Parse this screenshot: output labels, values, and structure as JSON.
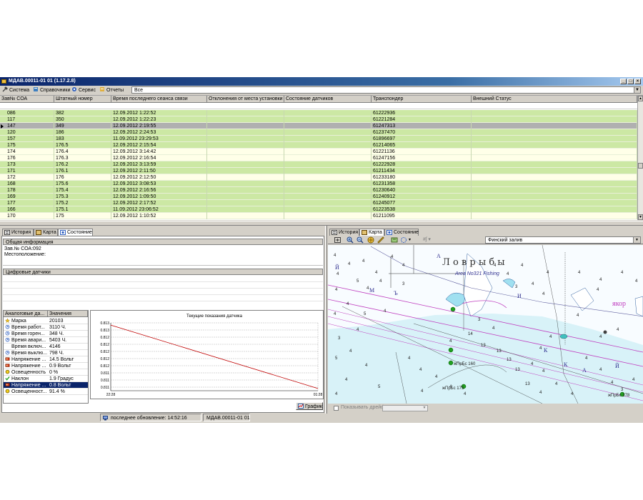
{
  "window": {
    "title": "МДАВ.00011-01 01 (1.17.2.8)"
  },
  "menu": {
    "items": [
      "Система",
      "Справочники",
      "Сервис",
      "Отчеты"
    ],
    "filter_value": "Все"
  },
  "grid": {
    "columns": [
      "Зав№ СОА",
      "Штатный номер",
      "Время последнего сеанса связи",
      "Отклонения от места установки",
      "Состояние датчиков",
      "Транспондер",
      "Внешний Статус"
    ],
    "rows": [
      {
        "zav": "086",
        "num": "382",
        "time": "12.09.2012 1:22:52",
        "tr": "61222936"
      },
      {
        "zav": "117",
        "num": "350",
        "time": "12.09.2012 1:22:23",
        "tr": "61221284"
      },
      {
        "zav": "147",
        "num": "349",
        "time": "12.09.2012 2:19:55",
        "tr": "61247313"
      },
      {
        "zav": "120",
        "num": "186",
        "time": "12.09.2012 2:24:53",
        "tr": "61237470"
      },
      {
        "zav": "157",
        "num": "183",
        "time": "11.09.2012 23:29:53",
        "tr": "61896697"
      },
      {
        "zav": "175",
        "num": "176.5",
        "time": "12.09.2012 2:15:54",
        "tr": "61214065"
      },
      {
        "zav": "174",
        "num": "176.4",
        "time": "12.09.2012 3:14:42",
        "tr": "61221136"
      },
      {
        "zav": "176",
        "num": "176.3",
        "time": "12.09.2012 2:16:54",
        "tr": "61247156"
      },
      {
        "zav": "173",
        "num": "176.2",
        "time": "12.09.2012 3:13:59",
        "tr": "61222928"
      },
      {
        "zav": "171",
        "num": "176.1",
        "time": "12.09.2012 2:11:50",
        "tr": "61211434"
      },
      {
        "zav": "172",
        "num": "176",
        "time": "12.09.2012 2:12:50",
        "tr": "61233180"
      },
      {
        "zav": "168",
        "num": "175.6",
        "time": "12.09.2012 3:08:53",
        "tr": "61231358"
      },
      {
        "zav": "178",
        "num": "175.4",
        "time": "12.09.2012 2:16:56",
        "tr": "61230640"
      },
      {
        "zav": "169",
        "num": "175.3",
        "time": "12.09.2012 1:09:50",
        "tr": "61240912"
      },
      {
        "zav": "177",
        "num": "175.2",
        "time": "12.09.2012 2:17:52",
        "tr": "61245077"
      },
      {
        "zav": "166",
        "num": "175.1",
        "time": "11.09.2012 23:06:52",
        "tr": "61223538"
      },
      {
        "zav": "170",
        "num": "175",
        "time": "12.09.2012 1:10:52",
        "tr": "61211095"
      }
    ]
  },
  "left_panel": {
    "tabs": [
      "История",
      "Карта",
      "Состояние"
    ],
    "general_title": "Общая информация",
    "zav_label": "Зав.№ СОА:092",
    "location_label": "Местоположение:",
    "digital_title": "Цифровые датчики",
    "analog_headers": [
      "Аналоговые да...",
      "Значения"
    ],
    "analog_rows": [
      {
        "name": "Марка",
        "value": "20103",
        "icon": "star-icon"
      },
      {
        "name": "Время работ...",
        "value": "3110 Ч.",
        "icon": "clock-icon"
      },
      {
        "name": "Время горен...",
        "value": "348 Ч.",
        "icon": "clock-icon"
      },
      {
        "name": "Время авари...",
        "value": "5403 Ч.",
        "icon": "clock-icon"
      },
      {
        "name": "Время включ...",
        "value": "4146",
        "icon": ""
      },
      {
        "name": "Время выклю...",
        "value": "798 Ч.",
        "icon": "clock-icon"
      },
      {
        "name": "Напряжение ...",
        "value": "14.5 Вольт",
        "icon": "battery-icon"
      },
      {
        "name": "Напряжение ...",
        "value": "0.9 Вольт",
        "icon": "battery-icon"
      },
      {
        "name": "Освещенность",
        "value": "0 %",
        "icon": "bulb-icon"
      },
      {
        "name": "Наклон",
        "value": "1.9 Градус",
        "icon": "check-icon"
      },
      {
        "name": "Напряжение ...",
        "value": "0.8 Вольт",
        "icon": "battery-icon"
      },
      {
        "name": "Освещенност...",
        "value": "91.4 %",
        "icon": "bulb-icon"
      }
    ],
    "chart_button": "График"
  },
  "chart_data": {
    "type": "line",
    "title": "Текущие показания датчика",
    "x_ticks": [
      "22:28",
      "01:28"
    ],
    "y_ticks": [
      "0.813",
      "0.813",
      "0.812",
      "0.812",
      "0.812",
      "0.812",
      "0.812",
      "0.811",
      "0.811",
      "0.811"
    ],
    "series": [
      {
        "x": [
          "22:28",
          "01:28"
        ],
        "values": [
          0.8134,
          0.8106
        ]
      }
    ],
    "ylim": [
      0.8105,
      0.8135
    ],
    "grid": true,
    "color": "#c00000"
  },
  "right_panel": {
    "tabs": [
      "История",
      "Карта",
      "Состояние"
    ],
    "map_select": "Финский залив",
    "map_labels": {
      "title1": "Л о в  р ы б ы",
      "title2": "Area No321 Fishing",
      "yakor": "якор",
      "buoys": [
        "жПрБс 175",
        "жПрБс 178",
        "жПрБс 160"
      ]
    },
    "show_drift": "Показывать дрейф"
  },
  "statusbar": {
    "update": "последнее обновление: 14:52:16",
    "id": "МДАВ.00011-01 01"
  },
  "colors": {
    "row_green": "#cce8a4",
    "row_white": "#ffffe8",
    "row_selected": "#b0b0b0",
    "title_bar": "#0a246a"
  }
}
